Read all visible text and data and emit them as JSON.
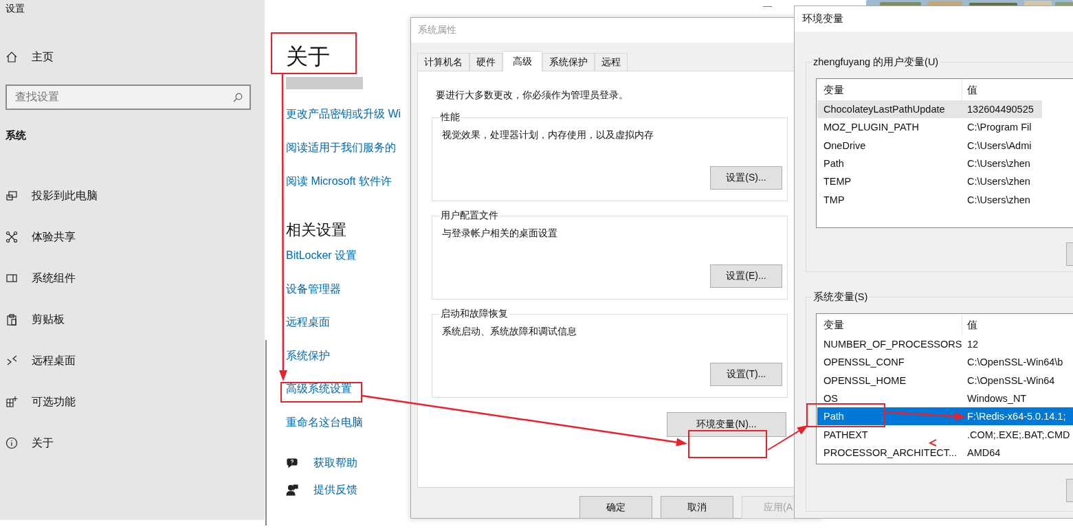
{
  "settings": {
    "title": "设置",
    "home": "主页",
    "search": {
      "placeholder": "查找设置"
    },
    "section": "系统",
    "nav": [
      {
        "label": "投影到此电脑",
        "kind": "project"
      },
      {
        "label": "体验共享",
        "kind": "share"
      },
      {
        "label": "系统组件",
        "kind": "components"
      },
      {
        "label": "剪贴板",
        "kind": "clipboard"
      },
      {
        "label": "远程桌面",
        "kind": "remote"
      },
      {
        "label": "可选功能",
        "kind": "optional"
      },
      {
        "label": "关于",
        "kind": "info"
      }
    ],
    "page_title": "关于",
    "links": [
      "更改产品密钥或升级 Wi",
      "阅读适用于我们服务的",
      "阅读 Microsoft 软件许"
    ],
    "related_title": "相关设置",
    "related_links": [
      "BitLocker 设置",
      "设备管理器",
      "远程桌面",
      "系统保护",
      "高级系统设置",
      "重命名这台电脑"
    ],
    "help": [
      {
        "label": "获取帮助",
        "kind": "help"
      },
      {
        "label": "提供反馈",
        "kind": "feedback"
      }
    ]
  },
  "system_properties": {
    "title": "系统属性",
    "tabs": [
      {
        "label": "计算机名",
        "selected": false
      },
      {
        "label": "硬件",
        "selected": false
      },
      {
        "label": "高级",
        "selected": true
      },
      {
        "label": "系统保护",
        "selected": false
      },
      {
        "label": "远程",
        "selected": false
      }
    ],
    "notice": "要进行大多数更改，你必须作为管理员登录。",
    "groups": [
      {
        "title": "性能",
        "description": "视觉效果，处理器计划，内存使用，以及虚拟内存",
        "button": "设置(S)..."
      },
      {
        "title": "用户配置文件",
        "description": "与登录帐户相关的桌面设置",
        "button": "设置(E)..."
      },
      {
        "title": "启动和故障恢复",
        "description": "系统启动、系统故障和调试信息",
        "button": "设置(T)..."
      }
    ],
    "env_button": "环境变量(N)...",
    "buttons": [
      {
        "label": "确定",
        "disabled": false
      },
      {
        "label": "取消",
        "disabled": false
      },
      {
        "label": "应用(A",
        "disabled": true
      }
    ]
  },
  "environment_variables": {
    "title": "环境变量",
    "user_group": {
      "title": "zhengfuyang 的用户变量(U)",
      "focused": false,
      "columns": [
        "变量",
        "值"
      ],
      "rows": [
        {
          "name": "ChocolateyLastPathUpdate",
          "value": "132604490525",
          "selected": true
        },
        {
          "name": "MOZ_PLUGIN_PATH",
          "value": "C:\\Program Fil",
          "selected": false
        },
        {
          "name": "OneDrive",
          "value": "C:\\Users\\Admi",
          "selected": false
        },
        {
          "name": "Path",
          "value": "C:\\Users\\zhen",
          "selected": false
        },
        {
          "name": "TEMP",
          "value": "C:\\Users\\zhen",
          "selected": false
        },
        {
          "name": "TMP",
          "value": "C:\\Users\\zhen",
          "selected": false
        }
      ]
    },
    "system_group": {
      "title": "系统变量(S)",
      "focused": true,
      "columns": [
        "变量",
        "值"
      ],
      "rows": [
        {
          "name": "NUMBER_OF_PROCESSORS",
          "value": "12",
          "selected": false
        },
        {
          "name": "OPENSSL_CONF",
          "value": "C:\\OpenSSL-Win64\\b",
          "selected": false
        },
        {
          "name": "OPENSSL_HOME",
          "value": "C:\\OpenSSL-Win64",
          "selected": false
        },
        {
          "name": "OS",
          "value": "Windows_NT",
          "selected": false
        },
        {
          "name": "Path",
          "value": "F:\\Redis-x64-5.0.14.1;",
          "selected": true
        },
        {
          "name": "PATHEXT",
          "value": ".COM;.EXE;.BAT;.CMD",
          "selected": false
        },
        {
          "name": "PROCESSOR_ARCHITECT...",
          "value": "AMD64",
          "selected": false
        }
      ]
    }
  }
}
